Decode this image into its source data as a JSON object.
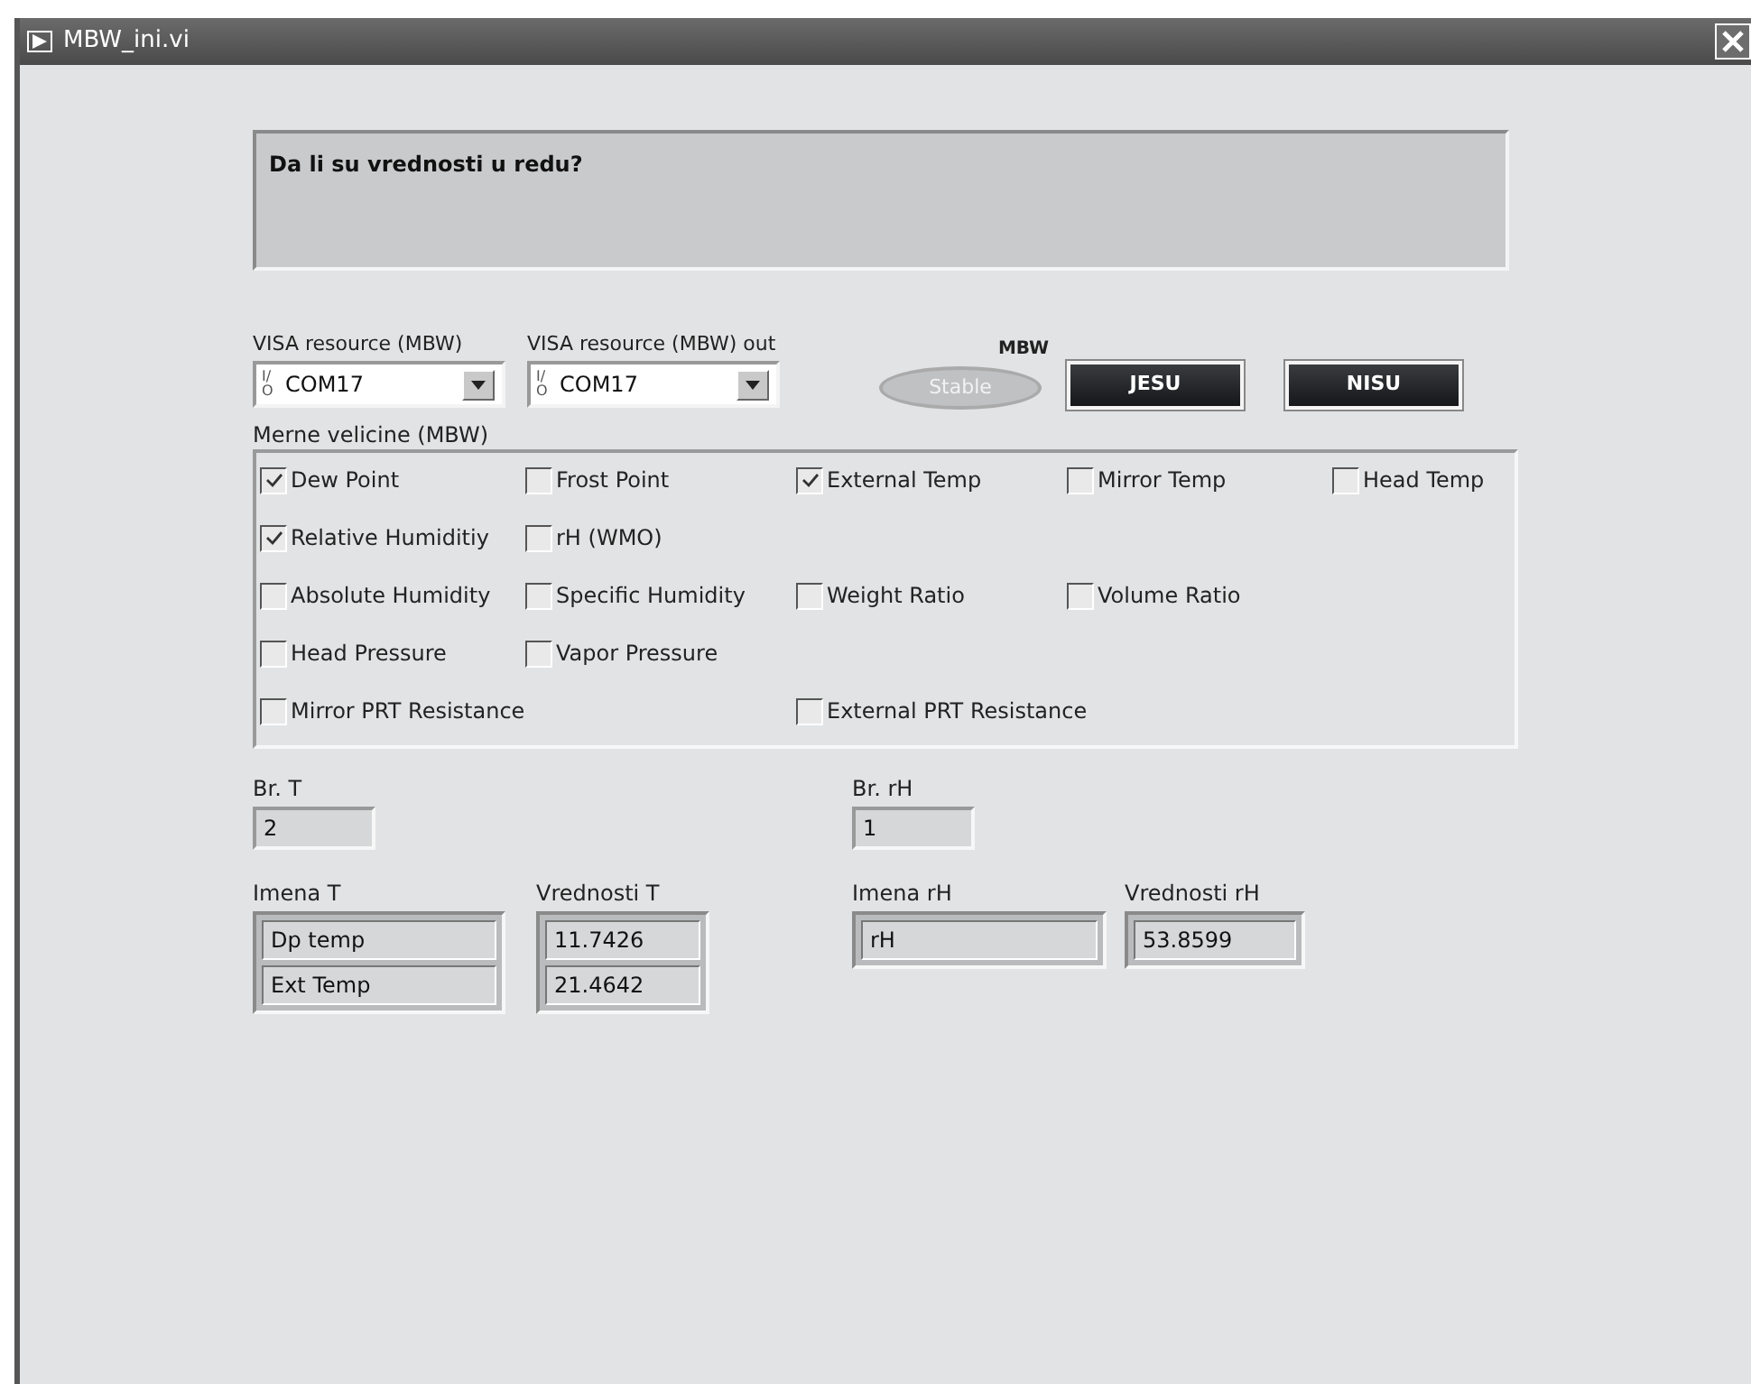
{
  "window": {
    "title": "MBW_ini.vi"
  },
  "message": "Da li su vrednosti u redu?",
  "visa_in": {
    "label": "VISA resource (MBW)",
    "io": "I/O",
    "value": "COM17"
  },
  "visa_out": {
    "label": "VISA resource (MBW) out",
    "io": "I/O",
    "value": "COM17"
  },
  "indicator": {
    "label": "MBW",
    "text": "Stable",
    "on": false
  },
  "buttons": [
    "JESU",
    "NISU"
  ],
  "measurements": {
    "label": "Merne velicine (MBW)",
    "rows": [
      [
        {
          "label": "Dew Point",
          "checked": true
        },
        {
          "label": "Frost Point",
          "checked": false
        },
        {
          "label": "External Temp",
          "checked": true
        },
        {
          "label": "Mirror Temp",
          "checked": false
        },
        {
          "label": "Head Temp",
          "checked": false
        }
      ],
      [
        {
          "label": "Relative Humiditiy",
          "checked": true
        },
        {
          "label": "rH (WMO)",
          "checked": false
        }
      ],
      [
        {
          "label": "Absolute Humidity",
          "checked": false
        },
        {
          "label": "Specific Humidity",
          "checked": false
        },
        {
          "label": "Weight Ratio",
          "checked": false
        },
        {
          "label": "Volume Ratio",
          "checked": false
        }
      ],
      [
        {
          "label": "Head Pressure",
          "checked": false
        },
        {
          "label": "Vapor Pressure",
          "checked": false
        }
      ],
      [
        {
          "label": "Mirror PRT Resistance",
          "checked": false
        },
        null,
        {
          "label": "External PRT Resistance",
          "checked": false
        }
      ]
    ]
  },
  "br_t": {
    "label": "Br. T",
    "value": "2"
  },
  "br_rh": {
    "label": "Br. rH",
    "value": "1"
  },
  "imena_t": {
    "label": "Imena T",
    "values": [
      "Dp temp",
      "Ext Temp"
    ]
  },
  "vrednosti_t": {
    "label": "Vrednosti T",
    "values": [
      "11.7426",
      "21.4642"
    ]
  },
  "imena_rh": {
    "label": "Imena rH",
    "values": [
      "rH"
    ]
  },
  "vrednosti_rh": {
    "label": "Vrednosti rH",
    "values": [
      "53.8599"
    ]
  }
}
